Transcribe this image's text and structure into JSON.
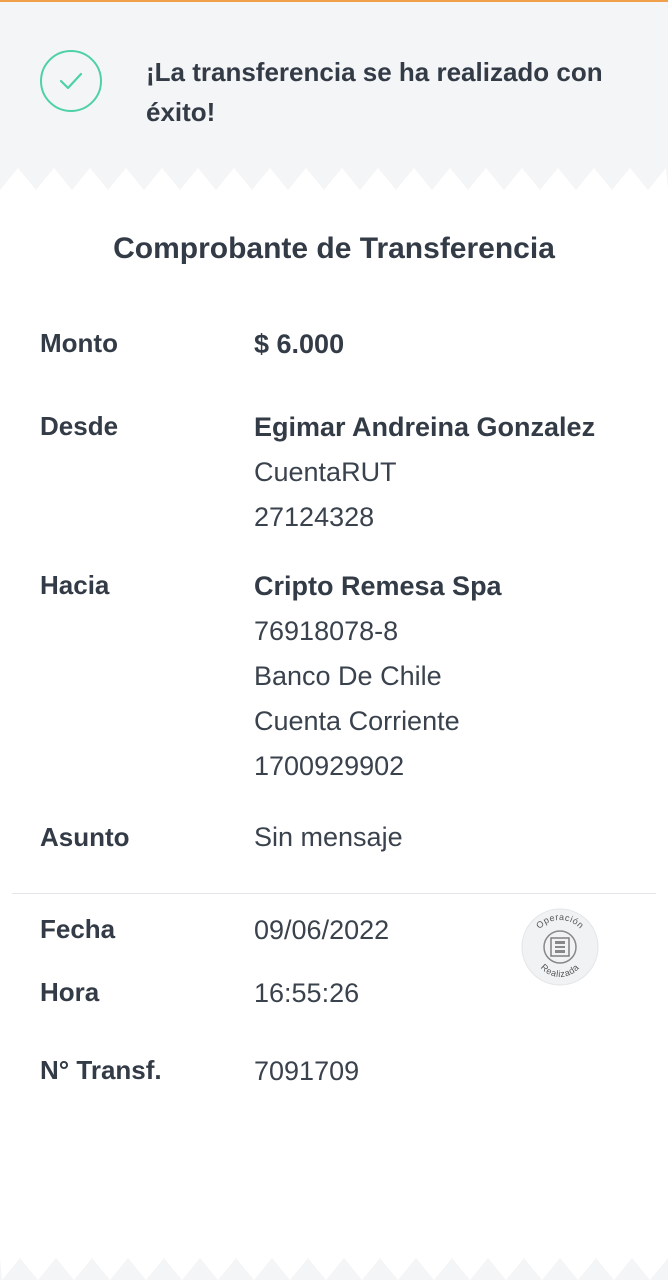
{
  "header": {
    "success_message": "¡La transferencia se ha realizado con éxito!",
    "icon": "check-icon",
    "accent_color": "#4fd1a6"
  },
  "receipt": {
    "title": "Comprobante de Transferencia",
    "monto": {
      "label": "Monto",
      "value": "$ 6.000"
    },
    "desde": {
      "label": "Desde",
      "name": "Egimar Andreina Gonzalez",
      "account_type": "CuentaRUT",
      "account_number": "27124328"
    },
    "hacia": {
      "label": "Hacia",
      "name": "Cripto Remesa Spa",
      "rut": "76918078-8",
      "bank": "Banco De Chile",
      "account_type": "Cuenta Corriente",
      "account_number": "1700929902"
    },
    "asunto": {
      "label": "Asunto",
      "value": "Sin mensaje"
    },
    "fecha": {
      "label": "Fecha",
      "value": "09/06/2022"
    },
    "hora": {
      "label": "Hora",
      "value": "16:55:26"
    },
    "transferencia": {
      "label": "N° Transf.",
      "value": "7091709"
    },
    "stamp": {
      "top_text": "Operación",
      "bottom_text": "Realizada",
      "icon": "bank-stamp-icon"
    }
  }
}
